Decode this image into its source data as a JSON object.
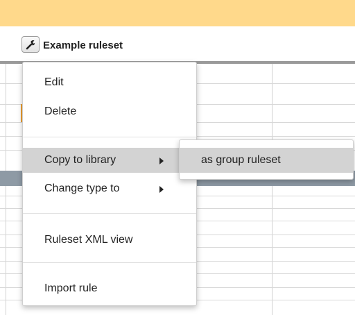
{
  "header": {
    "ruleset_title": "Example ruleset",
    "ruleset_icon": "wrench-icon"
  },
  "context_menu": {
    "items": [
      {
        "label": "Edit"
      },
      {
        "label": "Delete"
      },
      {
        "label": "Copy to library",
        "has_submenu": true,
        "highlighted": true
      },
      {
        "label": "Change type to",
        "has_submenu": true
      },
      {
        "label": "Ruleset XML view"
      },
      {
        "label": "Import rule"
      }
    ]
  },
  "submenu": {
    "items": [
      {
        "label": "as group ruleset",
        "highlighted": true
      }
    ]
  },
  "colors": {
    "top_bar": "#ffd98b",
    "highlight": "#d3d3d3",
    "band": "#8e9aa5"
  }
}
